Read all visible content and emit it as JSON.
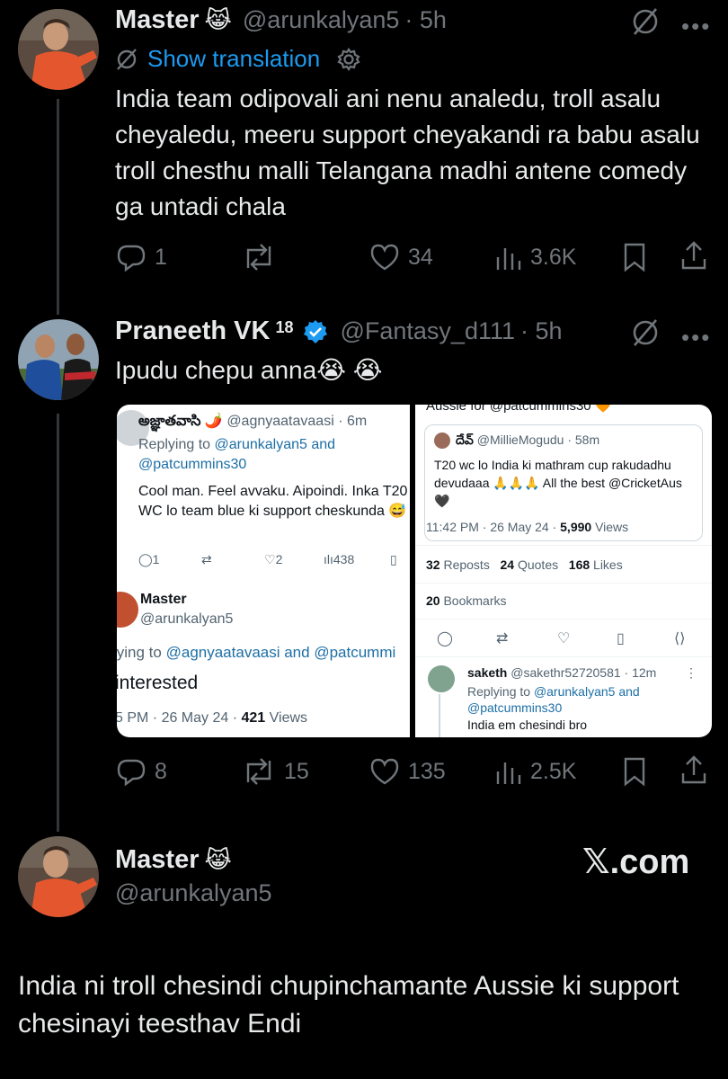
{
  "tweet1": {
    "name": "Master",
    "emoji": "😹",
    "handle": "@arunkalyan5",
    "time": "· 5h",
    "show_translation": "Show translation",
    "text": "India team odipovali ani nenu analedu, troll asalu cheyaledu, meeru support cheyakandi ra babu asalu troll chesthu malli Telangana madhi antene comedy ga untadi chala",
    "replies": "1",
    "retweets": "",
    "likes": "34",
    "views": "3.6K"
  },
  "tweet2": {
    "name": "Praneeth VK",
    "sup": "18",
    "handle": "@Fantasy_d111",
    "time": "· 5h",
    "text": "Ipudu chepu anna😭 😭",
    "replies": "8",
    "retweets": "15",
    "likes": "135",
    "views": "2.5K"
  },
  "left_shot": {
    "user": "అజ్ఞాతవాసి 🌶️",
    "handle": "@agnyaatavaasi · 6m",
    "replying_prefix": "Replying to",
    "replying_to": "@arunkalyan5 and @patcummins30",
    "text": "Cool man. Feel avvaku. Aipoindi. Inka T20 WC lo team blue ki support cheskunda 😅",
    "replies": "1",
    "likes": "2",
    "views": "438",
    "name2": "Master",
    "handle2": "@arunkalyan5",
    "replying2_prefix": "lying to",
    "replying2": "@agnyaatavaasi and @patcummi",
    "text2": "interested",
    "time2": "5 PM · 26 May 24 · ",
    "views2_count": "421",
    "views2_label": " Views"
  },
  "right_shot": {
    "top_text": "Aussie for @patcummins30 🧡",
    "quoted_name": "దేవ్",
    "quoted_handle": "@MillieMogudu · 58m",
    "quoted_text": "T20 wc lo India ki mathram cup rakudadhu devudaaa 🙏🙏🙏 All the best @CricketAus 🖤",
    "time": "11:42 PM · 26 May 24 · ",
    "views_count": "5,990",
    "views_label": " Views",
    "reposts_count": "32",
    "reposts_label": " Reposts",
    "quotes_count": "24",
    "quotes_label": " Quotes",
    "likes_count": "168",
    "likes_label": " Likes",
    "bookmarks_count": "20",
    "bookmarks_label": " Bookmarks",
    "reply_name": "saketh",
    "reply_handle": "@sakethr52720581 · 12m",
    "reply_replying_prefix": "Replying to",
    "reply_replying_to": "@arunkalyan5 and @patcummins30",
    "reply_text": "India em chesindi bro"
  },
  "tweet3": {
    "name": "Master",
    "emoji": "😹",
    "handle": "@arunkalyan5",
    "brand": "𝕏.com",
    "text": "India ni troll chesindi chupinchamante Aussie ki support chesinayi teesthav Endi"
  },
  "colors": {
    "accent": "#1d9bf0",
    "muted": "#71767b",
    "background": "#000000",
    "verified": "#1d9bf0"
  }
}
